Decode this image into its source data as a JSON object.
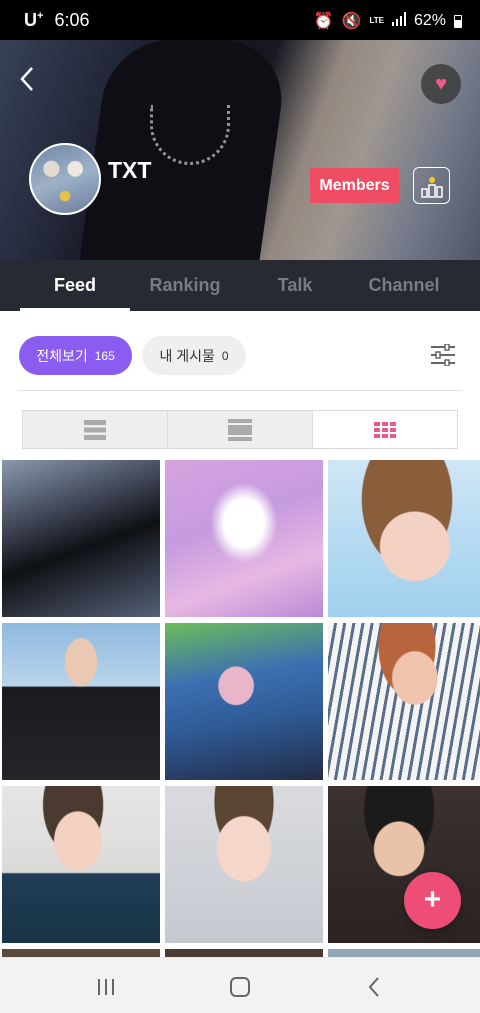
{
  "status_bar": {
    "carrier": "U",
    "carrier_sup": "+",
    "time": "6:06",
    "network": "LTE",
    "battery": "62%"
  },
  "header": {
    "group_name": "TXT",
    "members_label": "Members",
    "back_icon": "chevron-left-icon",
    "heart_icon": "heart-icon",
    "ranking_icon": "ranking-podium-icon"
  },
  "tabs": [
    {
      "label": "Feed",
      "active": true
    },
    {
      "label": "Ranking",
      "active": false
    },
    {
      "label": "Talk",
      "active": false
    },
    {
      "label": "Channel",
      "active": false
    }
  ],
  "filters": {
    "all_label": "전체보기",
    "all_count": "165",
    "mine_label": "내 게시물",
    "mine_count": "0",
    "settings_icon": "sliders-icon"
  },
  "view_modes": [
    {
      "icon": "list-view-icon",
      "active": false
    },
    {
      "icon": "card-view-icon",
      "active": false
    },
    {
      "icon": "grid-view-icon",
      "active": true
    }
  ],
  "fab": {
    "label": "+"
  },
  "nav_bar": {
    "recents_icon": "recents-icon",
    "home_icon": "home-icon",
    "back_icon": "back-icon"
  },
  "colors": {
    "accent_purple": "#8a5cf0",
    "members_red": "#ee4d63",
    "fab_pink": "#ee4d78",
    "heart_pink": "#f05a8c",
    "grid_active": "#e85a8a",
    "tab_bar": "#262a33"
  }
}
